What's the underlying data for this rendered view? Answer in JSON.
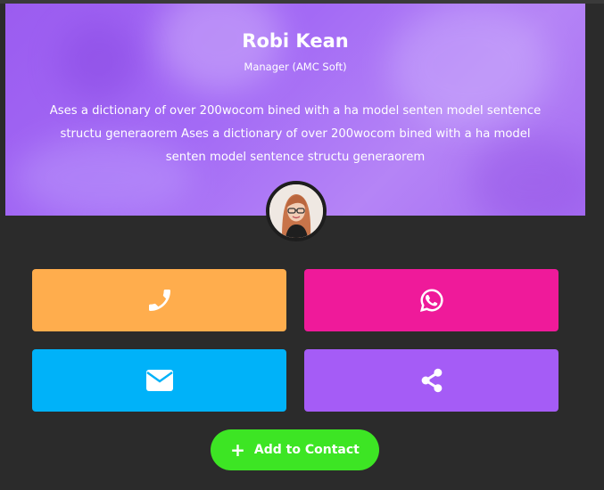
{
  "profile": {
    "name": "Robi Kean",
    "role": "Manager (AMC Soft)",
    "bio": "Ases a dictionary of over 200wocom bined with a ha model senten model sentence structu generaorem Ases a dictionary of over 200wocom bined with a ha model senten model sentence structu generaorem"
  },
  "actions": {
    "call": {
      "icon": "phone-icon",
      "color": "#ffad4d"
    },
    "whatsapp": {
      "icon": "whatsapp-icon",
      "color": "#ef1a9a"
    },
    "email": {
      "icon": "envelope-icon",
      "color": "#00b2f9"
    },
    "share": {
      "icon": "share-icon",
      "color": "#a55cf6"
    }
  },
  "add_contact": {
    "label": "Add to Contact",
    "icon": "plus-icon",
    "color": "#3de524"
  },
  "colors": {
    "background": "#2b2b2b",
    "hero_overlay": "#a36af5"
  }
}
